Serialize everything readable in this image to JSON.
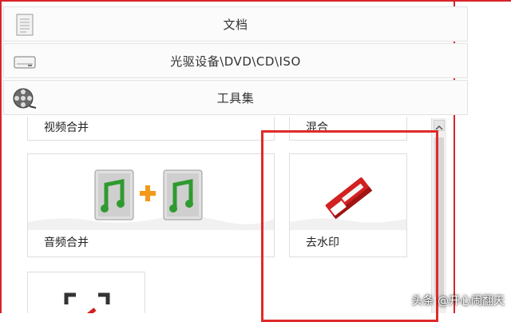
{
  "categories": {
    "doc": "文档",
    "optical": "光驱设备\\DVD\\CD\\ISO",
    "tools": "工具集"
  },
  "tiles": {
    "video_merge": "视频合并",
    "mix": "混合",
    "audio_merge": "音频合并",
    "remove_watermark": "去水印"
  },
  "watermark_text": "头条 @开心闹翻天",
  "colors": {
    "highlight": "#e02a2a",
    "frame": "#d9232a"
  }
}
